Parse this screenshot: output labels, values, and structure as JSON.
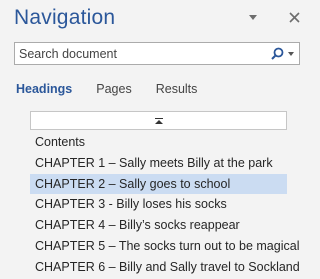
{
  "pane": {
    "title": "Navigation"
  },
  "search": {
    "placeholder": "Search document"
  },
  "tabs": [
    {
      "label": "Headings",
      "active": true
    },
    {
      "label": "Pages",
      "active": false
    },
    {
      "label": "Results",
      "active": false
    }
  ],
  "headings": [
    {
      "label": "Contents",
      "selected": false
    },
    {
      "label": "CHAPTER 1 – Sally meets Billy at the park",
      "selected": false
    },
    {
      "label": "CHAPTER 2 – Sally goes to school",
      "selected": true
    },
    {
      "label": "CHAPTER 3 - Billy loses his socks",
      "selected": false
    },
    {
      "label": "CHAPTER 4 – Billy’s socks reappear",
      "selected": false
    },
    {
      "label": "CHAPTER 5 – The socks turn out to be magical",
      "selected": false
    },
    {
      "label": "CHAPTER 6 – Billy and Sally travel to Sockland",
      "selected": false
    }
  ],
  "colors": {
    "accent": "#2b579a",
    "selection": "#cbdcf2",
    "background": "#f3f3f3"
  },
  "icons": {
    "pane_options": "chevron-down-icon",
    "close": "close-icon",
    "search": "search-icon",
    "collapse": "collapse-all-icon"
  }
}
